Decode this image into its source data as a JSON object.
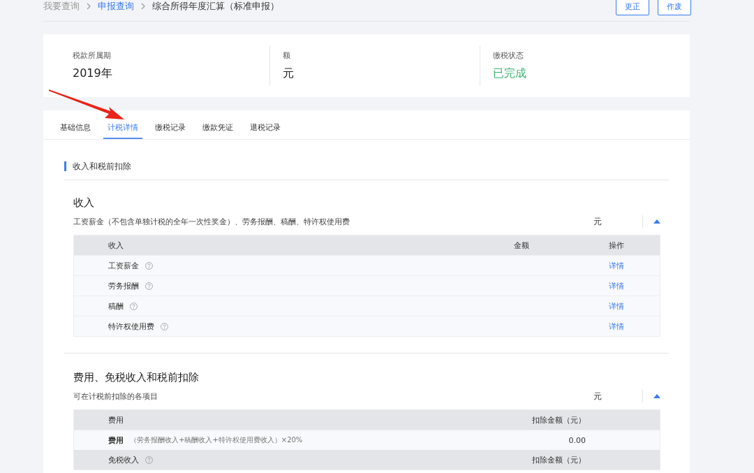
{
  "breadcrumb": [
    {
      "label": "我要查询",
      "kind": "plain"
    },
    {
      "label": "申报查询",
      "kind": "link"
    },
    {
      "label": "综合所得年度汇算（标准申报）",
      "kind": "current"
    }
  ],
  "actions": [
    "更正",
    "作废"
  ],
  "summary": [
    {
      "label": "税款所属期",
      "value": "2019年",
      "kind": "plain"
    },
    {
      "label": "额",
      "value": "元",
      "kind": "plain"
    },
    {
      "label": "缴税状态",
      "value": "已完成",
      "kind": "status"
    }
  ],
  "tabs": [
    {
      "label": "基础信息",
      "selected": false
    },
    {
      "label": "计税详情",
      "selected": true
    },
    {
      "label": "缴税记录",
      "selected": false
    },
    {
      "label": "缴款凭证",
      "selected": false
    },
    {
      "label": "退税记录",
      "selected": false
    }
  ],
  "section_title": "收入和税前扣除",
  "income": {
    "title": "收入",
    "subtitle": "工资薪金（不包含单独计税的全年一次性奖金）、劳务报酬、稿酬、特许权使用费",
    "total_unit": "元",
    "expanded": true,
    "columns": [
      "收入",
      "金额",
      "操作"
    ],
    "rows": [
      {
        "name": "工资薪金",
        "action": "详情"
      },
      {
        "name": "劳务报酬",
        "action": "详情"
      },
      {
        "name": "稿酬",
        "action": "详情"
      },
      {
        "name": "特许权使用费",
        "action": "详情"
      }
    ]
  },
  "deductions": {
    "title": "费用、免税收入和税前扣除",
    "subtitle": "可在计税前扣除的各项目",
    "total_unit": "元",
    "expanded": true,
    "blocks": [
      {
        "header": "费用",
        "header_help": false,
        "amount_header": "扣除金额（元）",
        "rows": [
          {
            "name": "费用",
            "note": "（劳务报酬收入+稿酬收入+特许权使用费收入）×20%",
            "amount": "0.00"
          }
        ]
      },
      {
        "header": "免税收入",
        "header_help": true,
        "amount_header": "扣除金额（元）"
      }
    ]
  }
}
